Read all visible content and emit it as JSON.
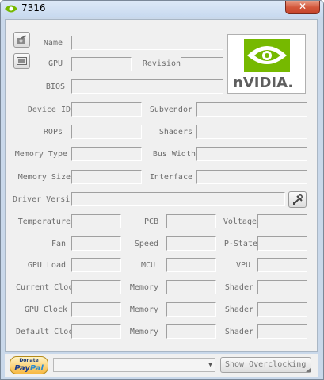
{
  "window": {
    "title": "7316"
  },
  "titlebar": {
    "close_glyph": "✕"
  },
  "card": {
    "name_label": "Name",
    "gpu_label": "GPU",
    "revision_label": "Revision",
    "bios_label": "BIOS",
    "device_id_label": "Device ID",
    "subvendor_label": "Subvendor",
    "rops_label": "ROPs",
    "shaders_label": "Shaders",
    "memory_type_label": "Memory Type",
    "bus_width_label": "Bus Width",
    "memory_size_label": "Memory Size",
    "interface_label": "Interface",
    "driver_version_label": "Driver Versi"
  },
  "logo": {
    "brand_text": "nVIDIA.",
    "brand_color": "#76b900"
  },
  "sensors": {
    "temperature_label": "Temperature",
    "pcb_label": "PCB",
    "voltage_label": "Voltage",
    "fan_label": "Fan",
    "speed_label": "Speed",
    "pstate_label": "P-State",
    "gpu_load_label": "GPU Load",
    "mcu_label": "MCU",
    "vpu_label": "VPU"
  },
  "clocks": {
    "current_clock_label": "Current Cloc",
    "gpu_clock_label": "GPU Clock",
    "default_clock_label": "Default Cloc",
    "memory_label": "Memory",
    "shader_label": "Shader"
  },
  "footer": {
    "donate_text": "Donate",
    "paypal_pay": "Pay",
    "paypal_pal": "Pal",
    "gpu_select_value": "",
    "overclocking_button": "Show Overclocking"
  },
  "icons": {
    "camera": "camera-icon",
    "screenshot": "screenshot-icon",
    "tools": "tools-icon",
    "app": "nvidia-eye-icon"
  }
}
